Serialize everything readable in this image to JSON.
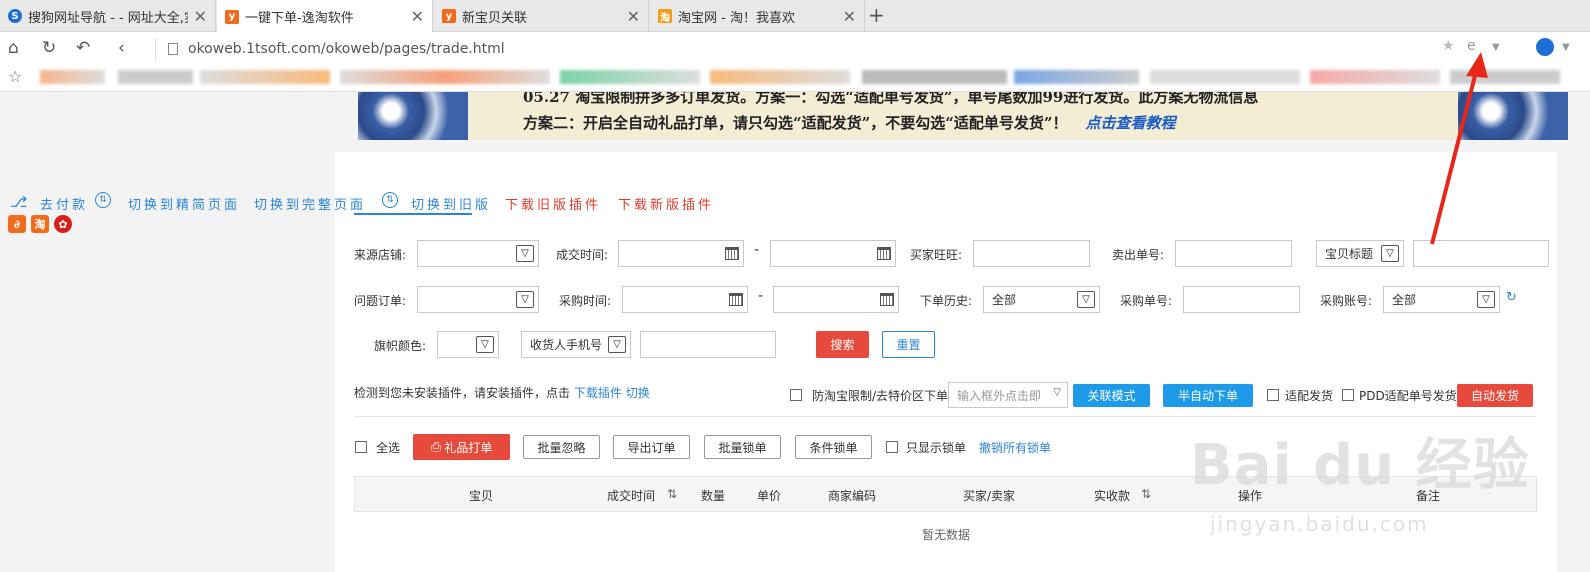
{
  "browser": {
    "tabs": [
      {
        "title": "搜狗网址导航 - - 网址大全,实",
        "icon_color": "#1d6fd6"
      },
      {
        "title": "一键下单-逸淘软件",
        "icon_color": "#f26a1b"
      },
      {
        "title": "新宝贝关联",
        "icon_color": "#f26a1b"
      },
      {
        "title": "淘宝网 - 淘！我喜欢",
        "icon_color": "#f39c12"
      }
    ],
    "new_tab": "+",
    "url": "okoweb.1tsoft.com/okoweb/pages/trade.html"
  },
  "banner": {
    "line1": "05.27 淘宝限制拼多多订单发货。方案一：勾选“适配单号发货”，单号尾数加99进行发货。此方案无物流信息",
    "line2": "方案二：开启全自动礼品打单，请只勾选“适配发货”，不要勾选“适配单号发货”！",
    "link": "点击查看教程"
  },
  "toplinks": {
    "pay": "去付款",
    "switch_simple": "切换到精简页面",
    "switch_full": "切换到完整页面",
    "switch_old": "切换到旧版",
    "download_old": "下载旧版插件",
    "download_new": "下载新版插件"
  },
  "mini_icons": {
    "tao": "淘"
  },
  "filters": {
    "source_shop": "来源店铺:",
    "deal_time": "成交时间:",
    "buyer_ww": "买家旺旺:",
    "sell_order_no": "卖出单号:",
    "item_title_select": "宝贝标题",
    "problem_order": "问题订单:",
    "purchase_time": "采购时间:",
    "order_history": "下单历史:",
    "order_history_value": "全部",
    "purchase_no": "采购单号:",
    "purchase_account": "采购账号:",
    "purchase_account_value": "全部",
    "flag_color": "旗帜颜色:",
    "phone_select": "收货人手机号",
    "search": "搜索",
    "reset": "重置",
    "dash": "-"
  },
  "plugin_notice": {
    "text": "检测到您未安装插件，请安装插件，点击",
    "download": "下载插件",
    "switch": "切换"
  },
  "options": {
    "anti_taobao": "防淘宝限制/去特价区下单",
    "click_outside_placeholder": "输入框外点击即",
    "link_mode": "关联模式",
    "semi_auto": "半自动下单",
    "adapt_ship": "适配发货",
    "pdd_adapt": "PDD适配单号发货",
    "auto_ship": "自动发货"
  },
  "actions": {
    "select_all": "全选",
    "gift_print": "礼品打单",
    "batch_ignore": "批量忽略",
    "export": "导出订单",
    "batch_lock": "批量锁单",
    "cond_lock": "条件锁单",
    "only_locked": "只显示锁单",
    "cancel_all_lock": "撤销所有锁单"
  },
  "table": {
    "columns": [
      "宝贝",
      "成交时间",
      "数量",
      "单价",
      "商家编码",
      "买家/卖家",
      "实收款",
      "操作",
      "备注"
    ],
    "empty": "暂无数据"
  },
  "watermark": {
    "big": "Bai du 经验",
    "small": "jingyan.baidu.com"
  },
  "colors": {
    "accent_blue": "#2a85d8",
    "accent_red": "#e64a3c",
    "button_blue": "#1e9be8"
  }
}
